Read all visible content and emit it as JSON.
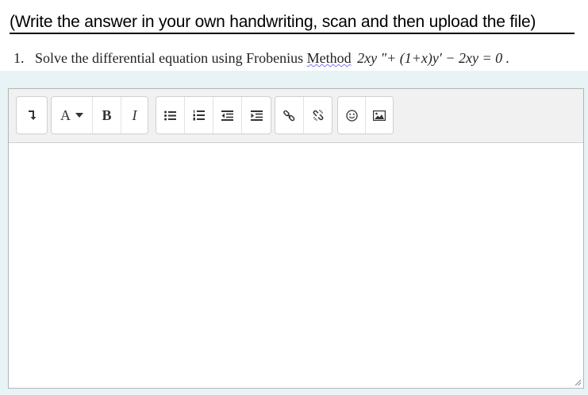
{
  "question": {
    "heading": "(Write the answer in your own handwriting, scan and then upload the file)",
    "number": "1.",
    "text": "Solve the differential equation using Frobenius",
    "method": "Method",
    "equation": "2xy \"+ (1+x)y′ − 2xy = 0 ."
  },
  "toolbar": {
    "font_label": "A",
    "bold_label": "B",
    "italic_label": "I"
  },
  "editor": {
    "content": ""
  }
}
